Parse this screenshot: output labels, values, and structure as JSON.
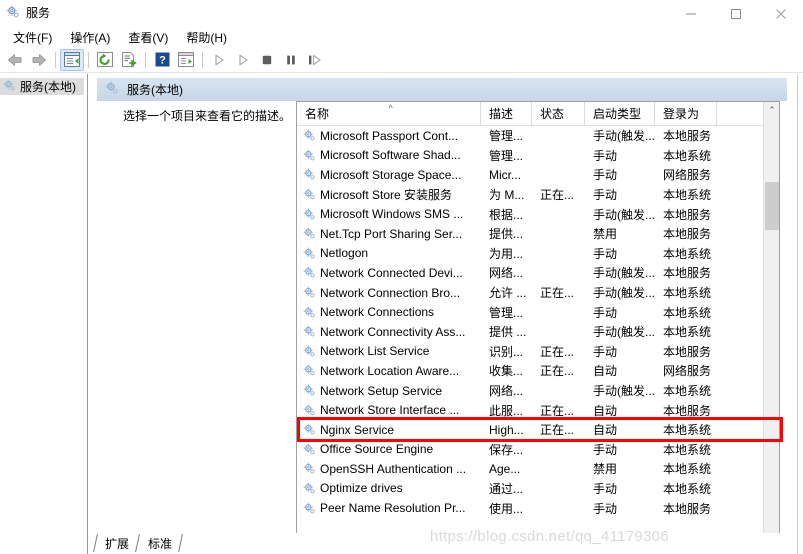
{
  "window": {
    "title": "服务",
    "icon": "services-gear-icon",
    "minimize_label": "—",
    "maximize_label": "□",
    "close_label": "✕"
  },
  "menu": {
    "items": [
      {
        "label": "文件(F)",
        "name": "menu-file"
      },
      {
        "label": "操作(A)",
        "name": "menu-action"
      },
      {
        "label": "查看(V)",
        "name": "menu-view"
      },
      {
        "label": "帮助(H)",
        "name": "menu-help"
      }
    ]
  },
  "toolbar": {
    "buttons": [
      {
        "name": "back-button",
        "icon": "back-arrow-icon"
      },
      {
        "name": "forward-button",
        "icon": "forward-arrow-icon"
      },
      {
        "name": "show-hide-tree-button",
        "icon": "console-tree-icon",
        "selected": true
      },
      {
        "name": "refresh-button",
        "icon": "refresh-icon"
      },
      {
        "name": "export-list-button",
        "icon": "export-list-icon"
      },
      {
        "name": "help-button",
        "icon": "question-help-icon"
      },
      {
        "name": "properties-button",
        "icon": "properties-window-icon"
      },
      {
        "name": "start-service-button",
        "icon": "play-icon"
      },
      {
        "name": "restart-service-button",
        "icon": "play-outline-icon"
      },
      {
        "name": "stop-service-button",
        "icon": "stop-square-icon"
      },
      {
        "name": "pause-service-button",
        "icon": "pause-icon"
      },
      {
        "name": "resume-service-button",
        "icon": "resume-icon"
      }
    ]
  },
  "tree": {
    "node_label": "服务(本地)",
    "node_icon": "services-gear-icon"
  },
  "panel": {
    "header_title": "服务(本地)",
    "header_icon": "services-gear-icon",
    "description": "选择一个项目来查看它的描述。"
  },
  "list": {
    "columns": [
      {
        "label": "名称",
        "name": "column-name",
        "sorted": true,
        "sort_glyph": "^"
      },
      {
        "label": "描述",
        "name": "column-description"
      },
      {
        "label": "状态",
        "name": "column-status"
      },
      {
        "label": "启动类型",
        "name": "column-startup-type"
      },
      {
        "label": "登录为",
        "name": "column-log-on-as"
      }
    ],
    "rows": [
      {
        "name": "Microsoft Passport Cont...",
        "description": "管理...",
        "status": "",
        "startup": "手动(触发...",
        "logon": "本地服务"
      },
      {
        "name": "Microsoft Software Shad...",
        "description": "管理...",
        "status": "",
        "startup": "手动",
        "logon": "本地系统"
      },
      {
        "name": "Microsoft Storage Space...",
        "description": "Micr...",
        "status": "",
        "startup": "手动",
        "logon": "网络服务"
      },
      {
        "name": "Microsoft Store 安装服务",
        "description": "为 M...",
        "status": "正在...",
        "startup": "手动",
        "logon": "本地系统"
      },
      {
        "name": "Microsoft Windows SMS ...",
        "description": "根据...",
        "status": "",
        "startup": "手动(触发...",
        "logon": "本地服务"
      },
      {
        "name": "Net.Tcp Port Sharing Ser...",
        "description": "提供...",
        "status": "",
        "startup": "禁用",
        "logon": "本地服务"
      },
      {
        "name": "Netlogon",
        "description": "为用...",
        "status": "",
        "startup": "手动",
        "logon": "本地系统"
      },
      {
        "name": "Network Connected Devi...",
        "description": "网络...",
        "status": "",
        "startup": "手动(触发...",
        "logon": "本地服务"
      },
      {
        "name": "Network Connection Bro...",
        "description": "允许 ...",
        "status": "正在...",
        "startup": "手动(触发...",
        "logon": "本地系统"
      },
      {
        "name": "Network Connections",
        "description": "管理...",
        "status": "",
        "startup": "手动",
        "logon": "本地系统"
      },
      {
        "name": "Network Connectivity Ass...",
        "description": "提供 ...",
        "status": "",
        "startup": "手动(触发...",
        "logon": "本地系统"
      },
      {
        "name": "Network List Service",
        "description": "识别...",
        "status": "正在...",
        "startup": "手动",
        "logon": "本地服务"
      },
      {
        "name": "Network Location Aware...",
        "description": "收集...",
        "status": "正在...",
        "startup": "自动",
        "logon": "网络服务"
      },
      {
        "name": "Network Setup Service",
        "description": "网络...",
        "status": "",
        "startup": "手动(触发...",
        "logon": "本地系统"
      },
      {
        "name": "Network Store Interface ...",
        "description": "此服...",
        "status": "正在...",
        "startup": "自动",
        "logon": "本地服务"
      },
      {
        "name": "Nginx Service",
        "description": "High...",
        "status": "正在...",
        "startup": "自动",
        "logon": "本地系统",
        "highlighted": true
      },
      {
        "name": "Office Source Engine",
        "description": "保存...",
        "status": "",
        "startup": "手动",
        "logon": "本地系统"
      },
      {
        "name": "OpenSSH Authentication ...",
        "description": "Age...",
        "status": "",
        "startup": "禁用",
        "logon": "本地系统"
      },
      {
        "name": "Optimize drives",
        "description": "通过...",
        "status": "",
        "startup": "手动",
        "logon": "本地系统"
      },
      {
        "name": "Peer Name Resolution Pr...",
        "description": "使用...",
        "status": "",
        "startup": "手动",
        "logon": "本地服务"
      }
    ],
    "scroll_up_glyph": "⌃",
    "scroll_down_glyph": "⌄"
  },
  "tabs": {
    "items": [
      {
        "label": "扩展",
        "name": "tab-extended"
      },
      {
        "label": "标准",
        "name": "tab-standard",
        "active": true
      }
    ]
  },
  "watermark": "https://blog.csdn.net/qq_41179306",
  "colors": {
    "highlight_red": "#ff0000",
    "panel_header": "#c6d6e8",
    "tree_selected": "#dcdcdc",
    "toolbar_selected": "#dceaf7"
  }
}
